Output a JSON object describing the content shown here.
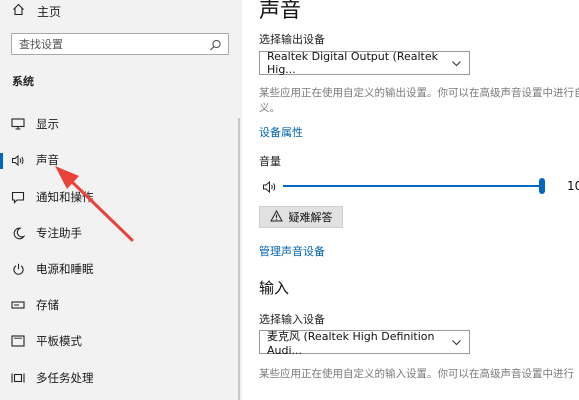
{
  "sidebar": {
    "home_label": "主页",
    "search_placeholder": "查找设置",
    "section_title": "系统",
    "items": [
      {
        "label": "显示",
        "icon": "monitor-icon"
      },
      {
        "label": "声音",
        "icon": "speaker-icon",
        "active": true
      },
      {
        "label": "通知和操作",
        "icon": "notification-icon"
      },
      {
        "label": "专注助手",
        "icon": "moon-icon"
      },
      {
        "label": "电源和睡眠",
        "icon": "power-icon"
      },
      {
        "label": "存储",
        "icon": "storage-icon"
      },
      {
        "label": "平板模式",
        "icon": "tablet-icon"
      },
      {
        "label": "多任务处理",
        "icon": "multitask-icon"
      }
    ]
  },
  "main": {
    "title": "声音",
    "output": {
      "label": "选择输出设备",
      "device": "Realtek Digital Output (Realtek Hig...",
      "description": "某些应用正在使用自定义的输出设置。你可以在高级声音设置中进行自定义。",
      "description_line2": "义。",
      "properties_link": "设备属性"
    },
    "volume": {
      "label": "音量",
      "value_text": "10",
      "level_percent": 100
    },
    "troubleshoot_label": "疑难解答",
    "manage_link": "管理声音设备",
    "input": {
      "section_title": "输入",
      "label": "选择输入设备",
      "device": "麦克风 (Realtek High Definition Audi...",
      "description": "某些应用正在使用自定义的输入设置。你可以在高级声音设置中进行"
    }
  },
  "colors": {
    "accent": "#0067c0",
    "link": "#0063b1",
    "annotation_arrow": "#e8423a"
  }
}
